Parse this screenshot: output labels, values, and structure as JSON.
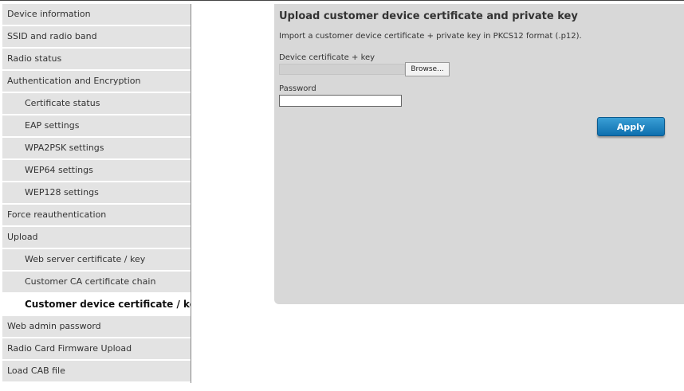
{
  "sidebar": {
    "items": [
      {
        "label": "Device information",
        "sub": false,
        "active": false
      },
      {
        "label": "SSID and radio band",
        "sub": false,
        "active": false
      },
      {
        "label": "Radio status",
        "sub": false,
        "active": false
      },
      {
        "label": "Authentication and Encryption",
        "sub": false,
        "active": false
      },
      {
        "label": "Certificate status",
        "sub": true,
        "active": false
      },
      {
        "label": "EAP settings",
        "sub": true,
        "active": false
      },
      {
        "label": "WPA2PSK settings",
        "sub": true,
        "active": false
      },
      {
        "label": "WEP64 settings",
        "sub": true,
        "active": false
      },
      {
        "label": "WEP128 settings",
        "sub": true,
        "active": false
      },
      {
        "label": "Force reauthentication",
        "sub": false,
        "active": false
      },
      {
        "label": "Upload",
        "sub": false,
        "active": false
      },
      {
        "label": "Web server certificate / key",
        "sub": true,
        "active": false
      },
      {
        "label": "Customer CA certificate chain",
        "sub": true,
        "active": false
      },
      {
        "label": "Customer device certificate / key",
        "sub": true,
        "active": true
      },
      {
        "label": "Web admin password",
        "sub": false,
        "active": false
      },
      {
        "label": "Radio Card Firmware Upload",
        "sub": false,
        "active": false
      },
      {
        "label": "Load CAB file",
        "sub": false,
        "active": false
      }
    ]
  },
  "main": {
    "title": "Upload customer device certificate and private key",
    "description": "Import a customer device certificate + private key in PKCS12 format (.p12).",
    "cert_label": "Device certificate + key",
    "browse_label": "Browse...",
    "password_label": "Password",
    "password_value": "",
    "apply_label": "Apply"
  },
  "colors": {
    "accent": "#1a7fc1",
    "nav_bg": "#e3e3e3",
    "panel_bg": "#d8d8d8"
  }
}
